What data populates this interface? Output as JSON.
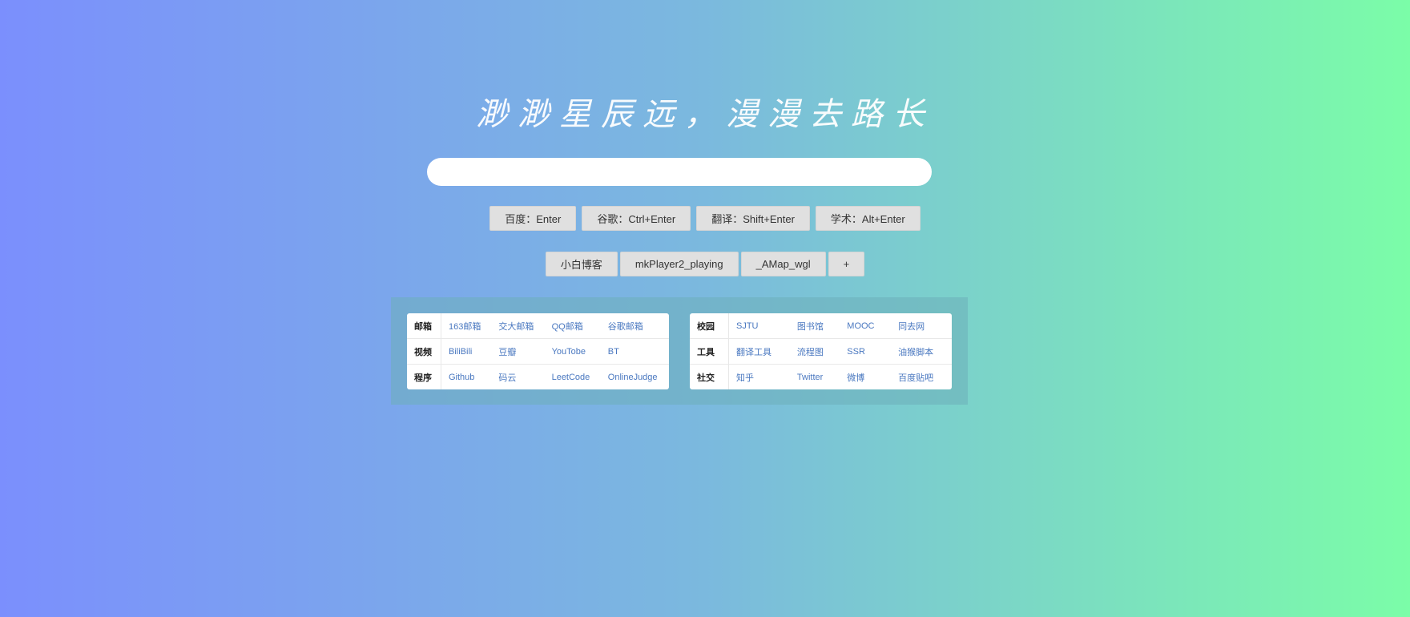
{
  "header": {
    "title": "渺渺星辰远，漫漫去路长"
  },
  "search": {
    "value": "",
    "placeholder": ""
  },
  "engines": [
    {
      "label": "百度：Enter"
    },
    {
      "label": "谷歌：Ctrl+Enter"
    },
    {
      "label": "翻译：Shift+Enter"
    },
    {
      "label": "学术：Alt+Enter"
    }
  ],
  "quick_links": [
    {
      "label": "小白博客"
    },
    {
      "label": "mkPlayer2_playing"
    },
    {
      "label": "_AMap_wgl"
    },
    {
      "label": "+"
    }
  ],
  "left_table": [
    {
      "category": "邮箱",
      "links": [
        "163邮箱",
        "交大邮箱",
        "QQ邮箱",
        "谷歌邮箱"
      ]
    },
    {
      "category": "视频",
      "links": [
        "BiliBili",
        "豆瓣",
        "YouTobe",
        "BT"
      ]
    },
    {
      "category": "程序",
      "links": [
        "Github",
        "码云",
        "LeetCode",
        "OnlineJudge"
      ]
    }
  ],
  "right_table": [
    {
      "category": "校园",
      "links": [
        "SJTU",
        "图书馆",
        "MOOC",
        "同去网"
      ]
    },
    {
      "category": "工具",
      "links": [
        "翻译工具",
        "流程图",
        "SSR",
        "油猴脚本"
      ]
    },
    {
      "category": "社交",
      "links": [
        "知乎",
        "Twitter",
        "微博",
        "百度贴吧"
      ]
    }
  ]
}
